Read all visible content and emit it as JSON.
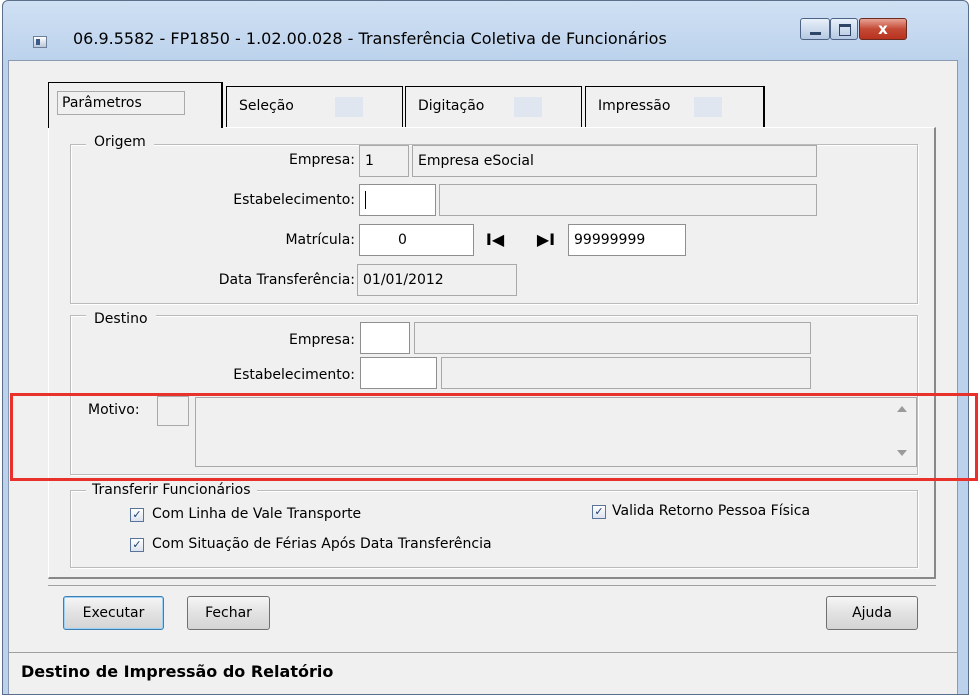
{
  "window": {
    "title": "06.9.5582 - FP1850 - 1.02.00.028 - Transferência Coletiva de Funcionários",
    "close_glyph": "x"
  },
  "tabs": [
    {
      "label": "Parâmetros",
      "active": true
    },
    {
      "label": "Seleção",
      "active": false
    },
    {
      "label": "Digitação",
      "active": false
    },
    {
      "label": "Impressão",
      "active": false
    }
  ],
  "origem": {
    "title": "Origem",
    "empresa_label": "Empresa:",
    "empresa_code": "1",
    "empresa_name": "Empresa eSocial",
    "estab_label": "Estabelecimento:",
    "estab_code": "",
    "estab_name": "",
    "matricula_label": "Matrícula:",
    "matricula_from": "0",
    "matricula_to": "99999999",
    "first_glyph": "I◀",
    "last_glyph": "▶I",
    "data_label": "Data Transferência:",
    "data_value": "01/01/2012"
  },
  "destino": {
    "title": "Destino",
    "empresa_label": "Empresa:",
    "empresa_code": "",
    "empresa_name": "",
    "estab_label": "Estabelecimento:",
    "estab_code": "",
    "estab_name": ""
  },
  "motivo": {
    "label": "Motivo:",
    "code": "",
    "text": ""
  },
  "transferir": {
    "title": "Transferir Funcionários",
    "options": [
      {
        "label": "Com Linha de Vale Transporte",
        "checked": true
      },
      {
        "label": "Com Situação de Férias Após Data Transferência",
        "checked": true
      },
      {
        "label": "Valida Retorno Pessoa Física",
        "checked": true
      }
    ]
  },
  "buttons": {
    "executar": "Executar",
    "fechar": "Fechar",
    "ajuda": "Ajuda"
  },
  "status": "Destino de Impressão do Relatório",
  "colors": {
    "highlight": "#e8312b"
  }
}
